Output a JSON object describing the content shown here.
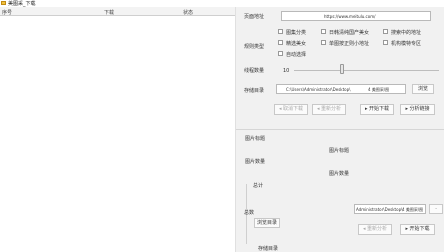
{
  "window": {
    "title": "美图采_下载"
  },
  "table": {
    "col_serial": "序号",
    "col_download": "下载",
    "col_status": "状态"
  },
  "form": {
    "page_url_label": "页面地址",
    "page_url_value": "https://www.meitulu.com/",
    "rule_label": "规则类型",
    "rules": [
      "图集分类",
      "日韩清纯国产美女",
      "搜索中的地址",
      "精选美女",
      "单图按正则小地址",
      "机构模特专区",
      "自动选择"
    ],
    "threads_label": "线程数量",
    "threads_value": "10",
    "save_dir_label": "存储目录",
    "save_dir_value": "C:\\Users\\Administrator\\Desktop\\",
    "save_dir_suffix": "4 美图采\\图",
    "browse_btn": "浏览",
    "cancel_btn": "取消下载",
    "reanalyze_btn": "重新分析",
    "start_btn": "开始下载",
    "analyze_btn": "分析链接"
  },
  "info": {
    "image_title_label": "图片标题",
    "image_title_value": "图片标题",
    "image_count_label": "图片数量",
    "image_count_value": "图片数量",
    "total_label": "总计",
    "total2_label": "总数",
    "save_dir2_value": "Administrator\\Desktop\\",
    "save_dir2_suffix": "4 美图采\\图",
    "browse2_btn": "浏览目录",
    "reanalyze2_btn": "重新分析",
    "start2_btn": "开始下载",
    "save_dir2_label": "存储目录"
  },
  "colors": {
    "title_icon": "#f3c23c",
    "panel_bg": "#f1f1f1"
  }
}
